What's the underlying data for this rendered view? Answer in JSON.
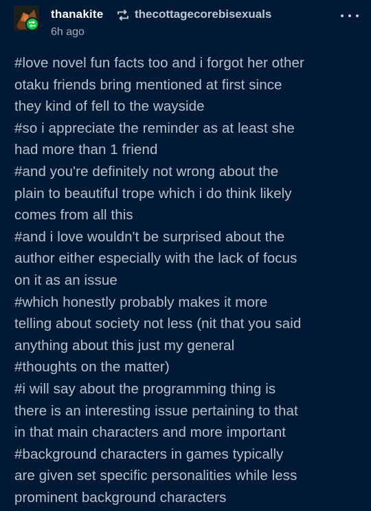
{
  "post": {
    "username": "thanakite",
    "reblogged_from": "thecottagecorebisexuals",
    "timestamp": "6h ago",
    "reblog_icon": "reblog-icon",
    "more_icon": "more-horizontal-icon",
    "colors": {
      "background": "#001935",
      "reblog_badge": "#00cf35"
    }
  },
  "tags": [
    "#love novel fun facts too and i forgot her other",
    "otaku friends bring mentioned at first since",
    "they kind of fell to the wayside",
    "#so i appreciate the reminder as at least she",
    "had more than 1 friend",
    "#and you're definitely not wrong about the",
    "plain to beautiful trope which i do think likely",
    "comes from all this",
    "#and i love wouldn't be surprised about the",
    "author either especially with the lack of focus",
    "on it as an issue",
    "#which honestly probably makes it more",
    "telling about society not less (nit that you said",
    "anything about this just my general",
    "#thoughts on the matter)",
    "#i will say about the programming thing is",
    "there is an interesting issue pertaining to that",
    "in that main characters and more important",
    "#background characters in games typically",
    "are given set specific personalities while less",
    "prominent background characters"
  ]
}
